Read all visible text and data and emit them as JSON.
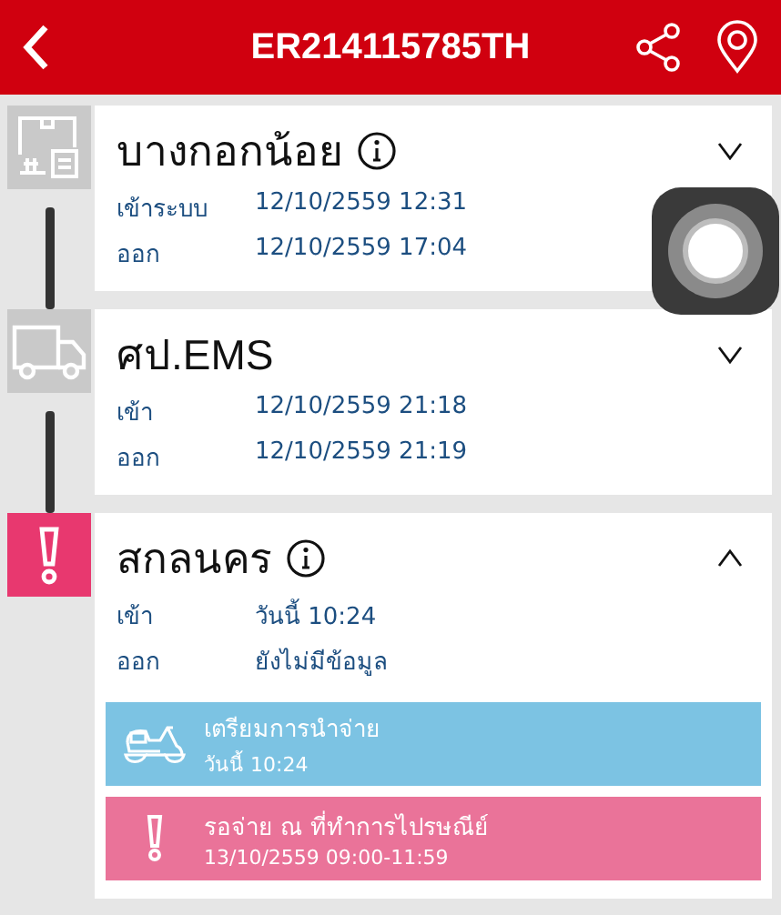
{
  "header": {
    "title": "ER214115785TH"
  },
  "stages": [
    {
      "kind": "warehouse",
      "name": "บางกอกน้อย",
      "info": true,
      "expanded": false,
      "rows": [
        {
          "label": "เข้าระบบ",
          "value": "12/10/2559 12:31"
        },
        {
          "label": "ออก",
          "value": "12/10/2559 17:04"
        }
      ]
    },
    {
      "kind": "truck",
      "name": "ศป.EMS",
      "info": false,
      "expanded": false,
      "rows": [
        {
          "label": "เข้า",
          "value": "12/10/2559 21:18"
        },
        {
          "label": "ออก",
          "value": "12/10/2559 21:19"
        }
      ]
    },
    {
      "kind": "alert",
      "name": "สกลนคร",
      "info": true,
      "expanded": true,
      "rows": [
        {
          "label": "เข้า",
          "value": "วันนี้ 10:24"
        },
        {
          "label": "ออก",
          "value": "ยังไม่มีข้อมูล"
        }
      ],
      "events": [
        {
          "kind": "scooter",
          "color": "#7cc3e3",
          "title": "เตรียมการนำจ่าย",
          "time": "วันนี้ 10:24"
        },
        {
          "kind": "alert",
          "color": "#ea7399",
          "title": "รอจ่าย ณ ที่ทำการไปรษณีย์",
          "time": "13/10/2559 09:00-11:59"
        }
      ]
    }
  ]
}
